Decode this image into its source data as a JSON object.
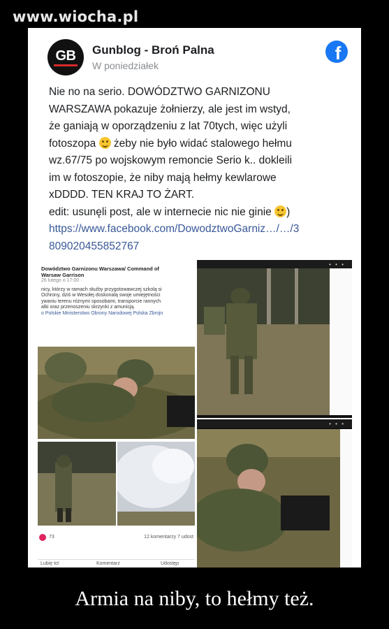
{
  "watermark": "www.wiocha.pl",
  "post": {
    "page_name": "Gunblog - Broń Palna",
    "time": "W poniedziałek",
    "avatar_text": "GB",
    "text_lines": [
      "Nie no na serio. DOWÓDZTWO GARNIZONU",
      "WARSZAWA pokazuje żołnierzy, ale jest im wstyd,",
      "że ganiają w oporządzeniu z lat 70tych, więc użyli",
      "fotoszopa",
      "żeby nie było widać stalowego hełmu",
      "wz.67/75 po wojskowym remoncie Serio k.. dokleili",
      "im w fotoszopie, że niby mają hełmy kewlarowe",
      "xDDDD. TEN KRAJ TO ŻART.",
      "edit: usunęli post, ale w internecie nic nie ginie",
      ")"
    ],
    "link_line1": "https://www.facebook.com/DowodztwoGarniz…/…/3",
    "link_line2": "809020455852767"
  },
  "screenshot": {
    "title_line1": "Dowództwo Garnizonu Warszawa/ Command of",
    "title_line2": "Warsaw Garrison",
    "date": "26 lutego o 17:00 ·",
    "body_lines": [
      "nicy, którzy w ramach służby przygotowawczej szkolą si",
      "Ochrony, dziś w Wesołej doskonalą swoje umiejętności",
      "ywaniu terenu różnymi sposobami, transporcie rannych",
      "alki oraz przenoszeniu skrzynki z amunicją."
    ],
    "link_text": "o Polskie Ministerstwo Obrony Narodowej Polska Zbrojn",
    "reaction_count": "73",
    "comments_count": "12 komentarzy  7 udost",
    "action_like": "Lubię to!",
    "action_comment": "Komentarz",
    "action_share": "Udostęp"
  },
  "caption": "Armia na niby, to hełmy też.",
  "colors": {
    "facebook_blue": "#1877f2",
    "link": "#385898",
    "background": "#000000"
  },
  "icons": [
    "facebook-logo-icon",
    "winking-emoji-icon",
    "heart-reaction-icon"
  ]
}
